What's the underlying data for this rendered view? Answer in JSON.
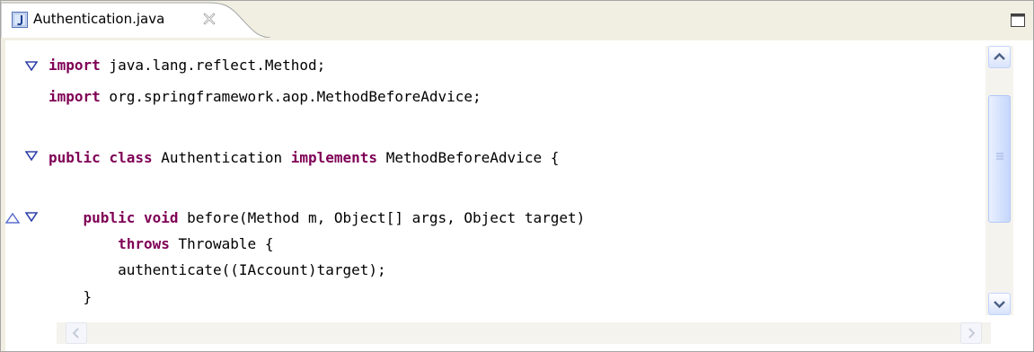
{
  "tab": {
    "title": "Authentication.java",
    "icon": "java-file-icon",
    "close_icon": "close-icon"
  },
  "window": {
    "maximize_icon": "maximize-icon"
  },
  "code": {
    "lines": [
      {
        "tokens": [
          {
            "t": "import",
            "kw": true
          },
          {
            "t": " java.lang.reflect.Method;",
            "kw": false
          }
        ]
      },
      {
        "tokens": [
          {
            "t": "import",
            "kw": true
          },
          {
            "t": " org.springframework.aop.MethodBeforeAdvice;",
            "kw": false
          }
        ]
      },
      {
        "tokens": []
      },
      {
        "tokens": [
          {
            "t": "public",
            "kw": true
          },
          {
            "t": " ",
            "kw": false
          },
          {
            "t": "class",
            "kw": true
          },
          {
            "t": " Authentication ",
            "kw": false
          },
          {
            "t": "implements",
            "kw": true
          },
          {
            "t": " MethodBeforeAdvice {",
            "kw": false
          }
        ]
      },
      {
        "tokens": []
      },
      {
        "tokens": [
          {
            "t": "    ",
            "kw": false
          },
          {
            "t": "public",
            "kw": true
          },
          {
            "t": " ",
            "kw": false
          },
          {
            "t": "void",
            "kw": true
          },
          {
            "t": " before(Method m, Object[] args, Object target)",
            "kw": false
          }
        ]
      },
      {
        "tokens": [
          {
            "t": "        ",
            "kw": false
          },
          {
            "t": "throws",
            "kw": true
          },
          {
            "t": " Throwable {",
            "kw": false
          }
        ]
      },
      {
        "tokens": [
          {
            "t": "        authenticate((IAccount)target);",
            "kw": false
          }
        ]
      },
      {
        "tokens": [
          {
            "t": "    }",
            "kw": false
          }
        ]
      }
    ]
  },
  "colors": {
    "keyword": "#7f0055",
    "fold_marker": "#3344aa",
    "override_marker": "#5b6ecf"
  },
  "icons": {
    "fold_expanded": "fold-expanded-icon",
    "override": "override-indicator-icon",
    "scroll_up": "scroll-up-icon",
    "scroll_down": "scroll-down-icon",
    "scroll_left": "scroll-left-icon",
    "scroll_right": "scroll-right-icon"
  }
}
